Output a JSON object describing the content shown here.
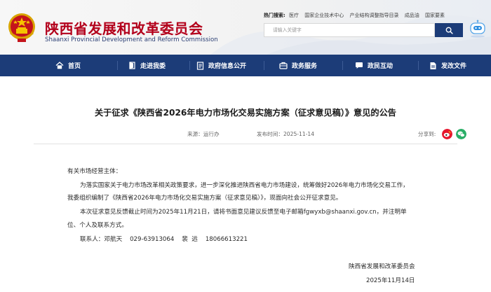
{
  "header": {
    "site_title": "陕西省发展和改革委员会",
    "site_subtitle": "Shaanxi Provincial Development and Reform Commission",
    "hot_words_label": "热门搜索:",
    "hot_words": [
      "医疗",
      "国家企业技术中心",
      "产业结构调整指导目录",
      "成品油",
      "国家要素"
    ],
    "search_placeholder": "请输入关键字",
    "brand_color": "#b3001b",
    "accent_color": "#1c3c78"
  },
  "nav": {
    "items": [
      {
        "label": "首页",
        "icon": "home-icon"
      },
      {
        "label": "走进我委",
        "icon": "door-icon"
      },
      {
        "label": "政府信息公开",
        "icon": "document-icon"
      },
      {
        "label": "政务服务",
        "icon": "service-icon"
      },
      {
        "label": "政民互动",
        "icon": "chat-icon"
      },
      {
        "label": "发改文件",
        "icon": "file-icon"
      }
    ]
  },
  "article": {
    "title": "关于征求《陕西省2026年电力市场化交易实施方案（征求意见稿）》意见的公告",
    "source_label": "来源：",
    "source": "运行办",
    "date_label": "发布时间：",
    "date": "2025-11-14",
    "share_label": "分享到:",
    "share_icons": [
      "weibo-icon",
      "wechat-icon"
    ],
    "salutation": "有关市场经营主体：",
    "para1_line1": "为落实国家关于电力市场改革相关政策要求，进一步深化推进陕西省电力市场建设，统筹做好2026年电力市场化交易工作，",
    "para1_line2": "我委组织编制了《陕西省2026年电力市场化交易实施方案（征求意见稿）》，现面向社会公开征求意见。",
    "para2_line1": "本次征求意见反馈截止时间为2025年11月21日，请将书面意见建议反馈至电子邮箱fgwyxb@shaanxi.gov.cn，并注明单",
    "para2_line2": "位、个人及联系方式。",
    "contact": "联系人：邓航天    029-63913064    裴  远    18066613221",
    "signature_org": "陕西省发展和改革委员会",
    "signature_date": "2025年11月14日"
  }
}
